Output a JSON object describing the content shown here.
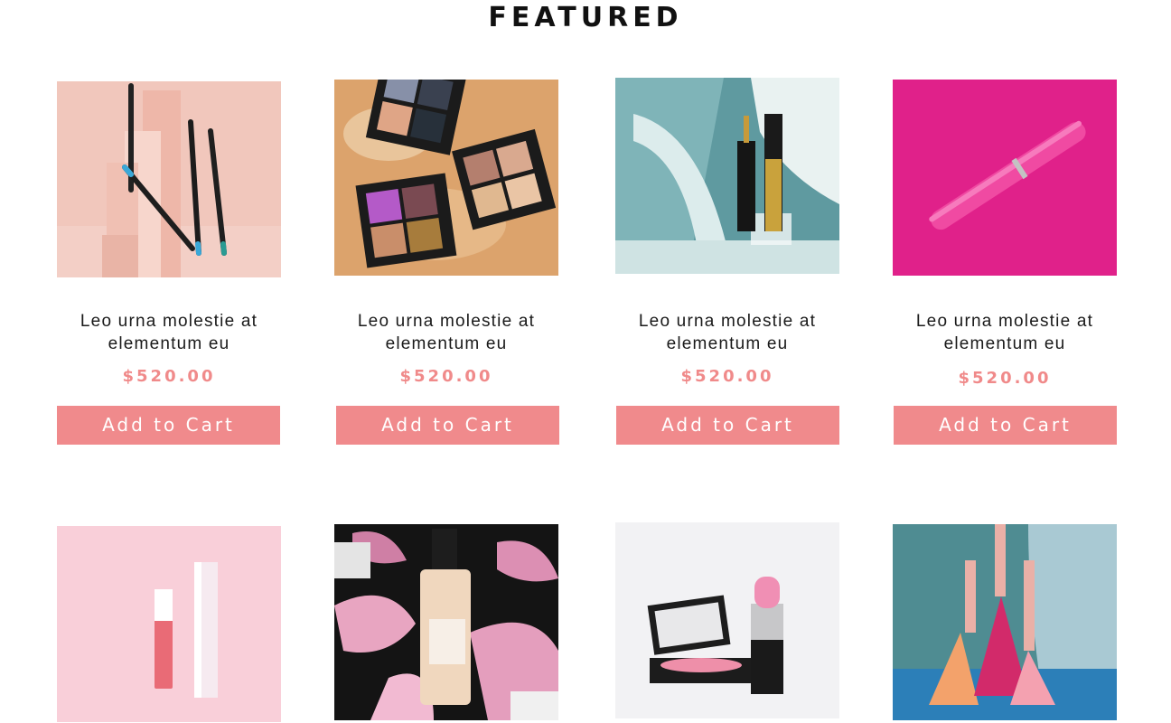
{
  "section": {
    "title": "FEATURED"
  },
  "colors": {
    "accent": "#f08a8c",
    "price": "#f08a8a",
    "text": "#1a1a1a"
  },
  "products": [
    {
      "name": "Leo urna molestie at elementum eu",
      "price": "$520.00",
      "cta": "Add to Cart",
      "image": "eyeliner-pencils-photo"
    },
    {
      "name": "Leo urna molestie at elementum eu",
      "price": "$520.00",
      "cta": "Add to Cart",
      "image": "eyeshadow-palettes-photo"
    },
    {
      "name": "Leo urna molestie at elementum eu",
      "price": "$520.00",
      "cta": "Add to Cart",
      "image": "lip-gloss-photo"
    },
    {
      "name": "Leo urna molestie at elementum eu",
      "price": "$520.00",
      "cta": "Add to Cart",
      "image": "pink-marker-photo"
    },
    {
      "name": "",
      "price": "",
      "cta": "",
      "image": "liquid-lipstick-photo"
    },
    {
      "name": "",
      "price": "",
      "cta": "",
      "image": "foundation-bottle-photo"
    },
    {
      "name": "",
      "price": "",
      "cta": "",
      "image": "lipstick-blush-compact-photo"
    },
    {
      "name": "",
      "price": "",
      "cta": "",
      "image": "lip-gloss-trio-photo"
    }
  ]
}
